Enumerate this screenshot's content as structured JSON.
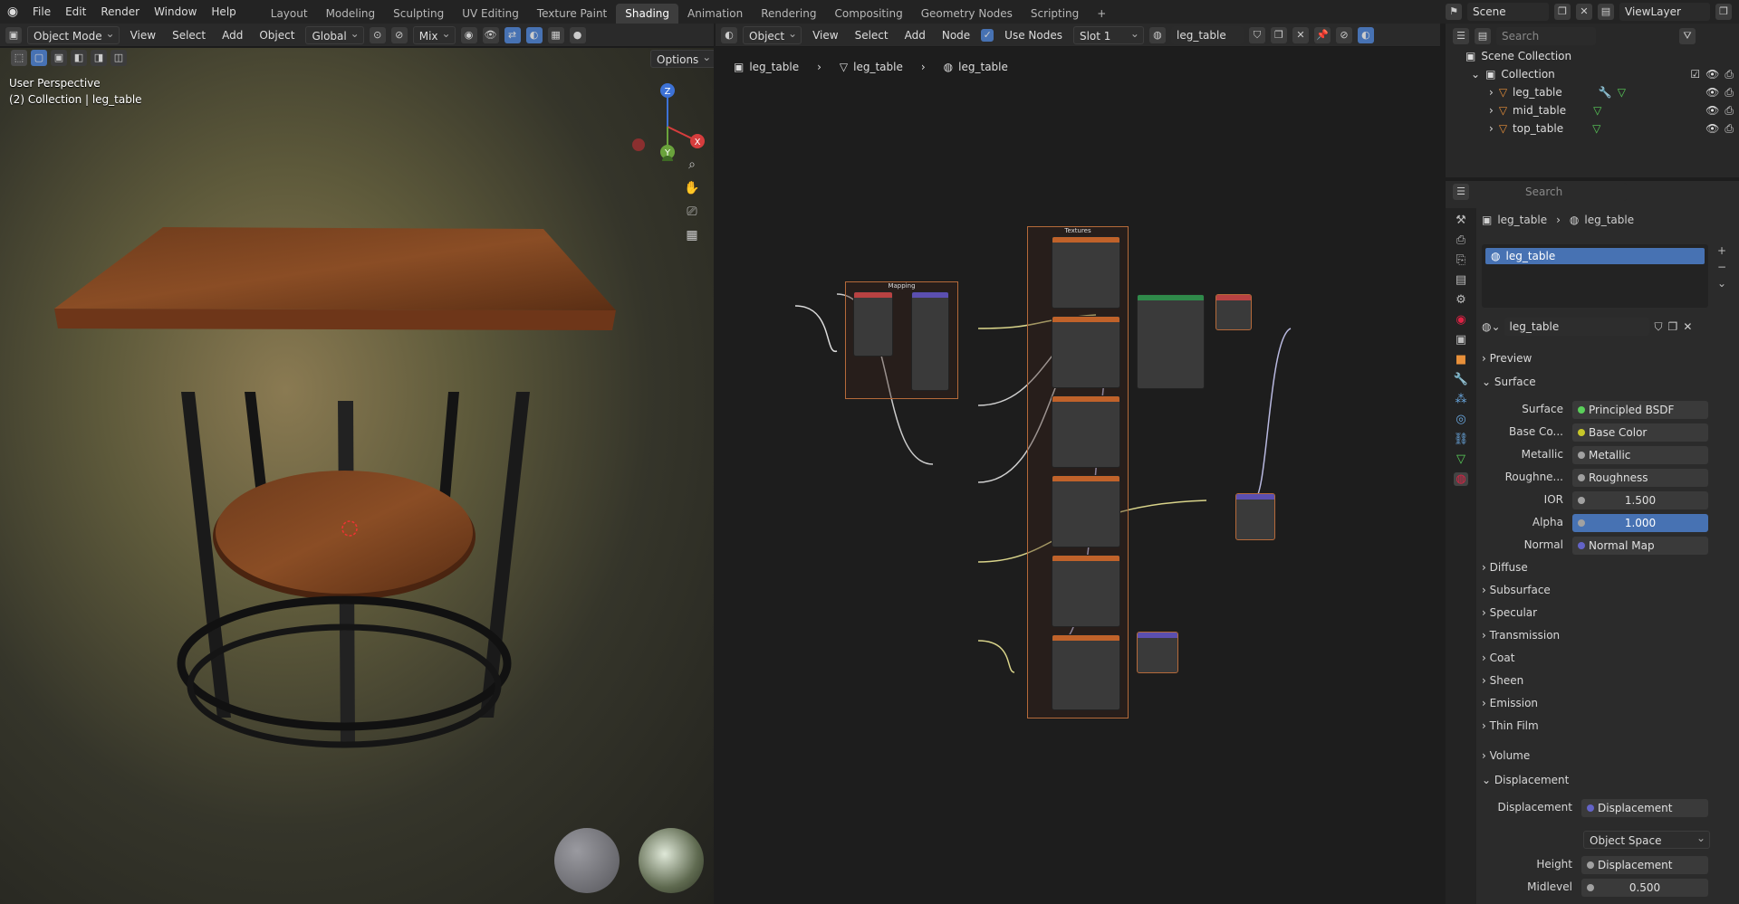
{
  "topbar": {
    "menus": [
      "File",
      "Edit",
      "Render",
      "Window",
      "Help"
    ],
    "workspaces": [
      "Layout",
      "Modeling",
      "Sculpting",
      "UV Editing",
      "Texture Paint",
      "Shading",
      "Animation",
      "Rendering",
      "Compositing",
      "Geometry Nodes",
      "Scripting"
    ],
    "active_workspace": "Shading",
    "add_tab": "+",
    "scene_label": "Scene",
    "viewlayer_label": "ViewLayer"
  },
  "viewport": {
    "mode": "Object Mode",
    "menus": [
      "View",
      "Select",
      "Add",
      "Object"
    ],
    "orientation": "Global",
    "pivot": "Mix",
    "options": "Options",
    "overlay_title": "User Perspective",
    "overlay_sub": "(2) Collection | leg_table",
    "gizmo": {
      "z": "Z",
      "x": "X",
      "y": "Y"
    }
  },
  "node_editor": {
    "type": "Object",
    "menus": [
      "View",
      "Select",
      "Add",
      "Node"
    ],
    "use_nodes_label": "Use Nodes",
    "slot": "Slot 1",
    "material": "leg_table",
    "breadcrumb": [
      "leg_table",
      "leg_table",
      "leg_table"
    ],
    "frame_mapping": "Mapping",
    "frame_textures": "Textures"
  },
  "outliner": {
    "search_placeholder": "Search",
    "scene_collection": "Scene Collection",
    "collection": "Collection",
    "objects": [
      "leg_table",
      "mid_table",
      "top_table"
    ]
  },
  "properties": {
    "search_placeholder": "Search",
    "breadcrumb": [
      "leg_table",
      "leg_table"
    ],
    "slot_item": "leg_table",
    "material_name": "leg_table",
    "preview": "Preview",
    "surface_section": "Surface",
    "surface_label": "Surface",
    "surface_value": "Principled BSDF",
    "rows": [
      {
        "label": "Base Co...",
        "value": "Base Color",
        "color": "#c7c729"
      },
      {
        "label": "Metallic",
        "value": "Metallic",
        "color": "#a1a1a1"
      },
      {
        "label": "Roughne...",
        "value": "Roughness",
        "color": "#a1a1a1"
      }
    ],
    "ior_label": "IOR",
    "ior_value": "1.500",
    "alpha_label": "Alpha",
    "alpha_value": "1.000",
    "normal_label": "Normal",
    "normal_value": "Normal Map",
    "subsections": [
      "Diffuse",
      "Subsurface",
      "Specular",
      "Transmission",
      "Coat",
      "Sheen",
      "Emission",
      "Thin Film"
    ],
    "volume": "Volume",
    "displacement_section": "Displacement",
    "displacement_label": "Displacement",
    "displacement_value": "Displacement",
    "space_value": "Object Space",
    "height_label": "Height",
    "height_value": "Displacement",
    "midlevel_label": "Midlevel",
    "midlevel_value": "0.500"
  }
}
